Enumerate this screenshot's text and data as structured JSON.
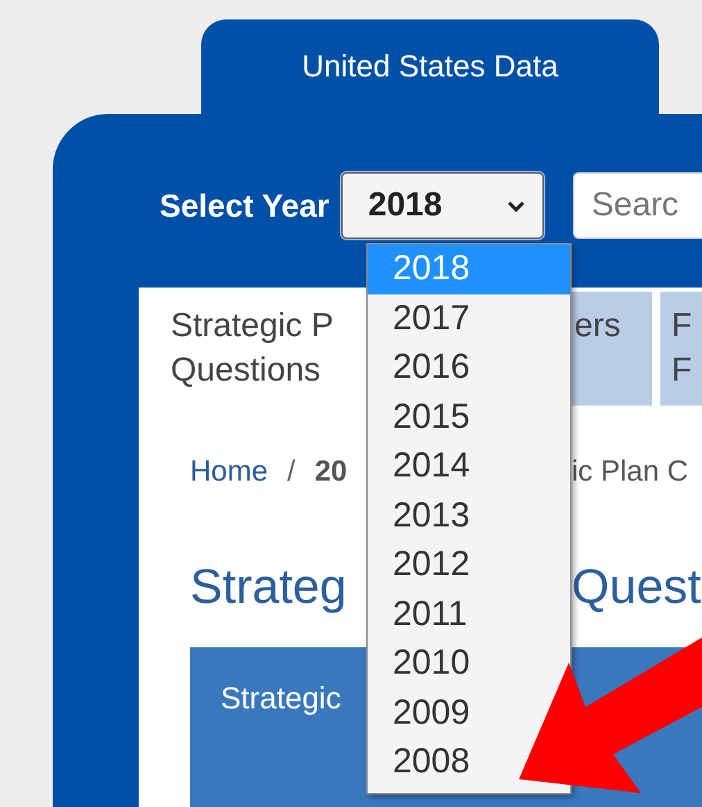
{
  "tabs": [
    {
      "label": "United States Data",
      "selected": true
    }
  ],
  "year_select": {
    "label": "Select Year",
    "value": "2018",
    "expanded": true,
    "options": [
      {
        "label": "2018",
        "selected": true
      },
      {
        "label": "2017",
        "selected": false
      },
      {
        "label": "2016",
        "selected": false
      },
      {
        "label": "2015",
        "selected": false
      },
      {
        "label": "2014",
        "selected": false
      },
      {
        "label": "2013",
        "selected": false
      },
      {
        "label": "2012",
        "selected": false
      },
      {
        "label": "2011",
        "selected": false
      },
      {
        "label": "2010",
        "selected": false
      },
      {
        "label": "2009",
        "selected": false
      },
      {
        "label": "2008",
        "selected": false
      }
    ]
  },
  "search": {
    "placeholder": "Searc"
  },
  "subtabs": [
    {
      "lines": [
        "Strategic P",
        "Questions"
      ],
      "selected": true
    },
    {
      "lines": [
        "ers"
      ],
      "selected": false
    },
    {
      "lines": [
        "F",
        "F"
      ],
      "selected": false
    }
  ],
  "breadcrumb": [
    {
      "text": "Home",
      "kind": "link"
    },
    {
      "text": "/",
      "kind": "separator"
    },
    {
      "text": "20",
      "kind": "current"
    }
  ],
  "breadcrumb_right": "ic Plan C",
  "heading": [
    "Strateg",
    "Quest"
  ],
  "table": {
    "columns": [
      "Strategic"
    ]
  }
}
